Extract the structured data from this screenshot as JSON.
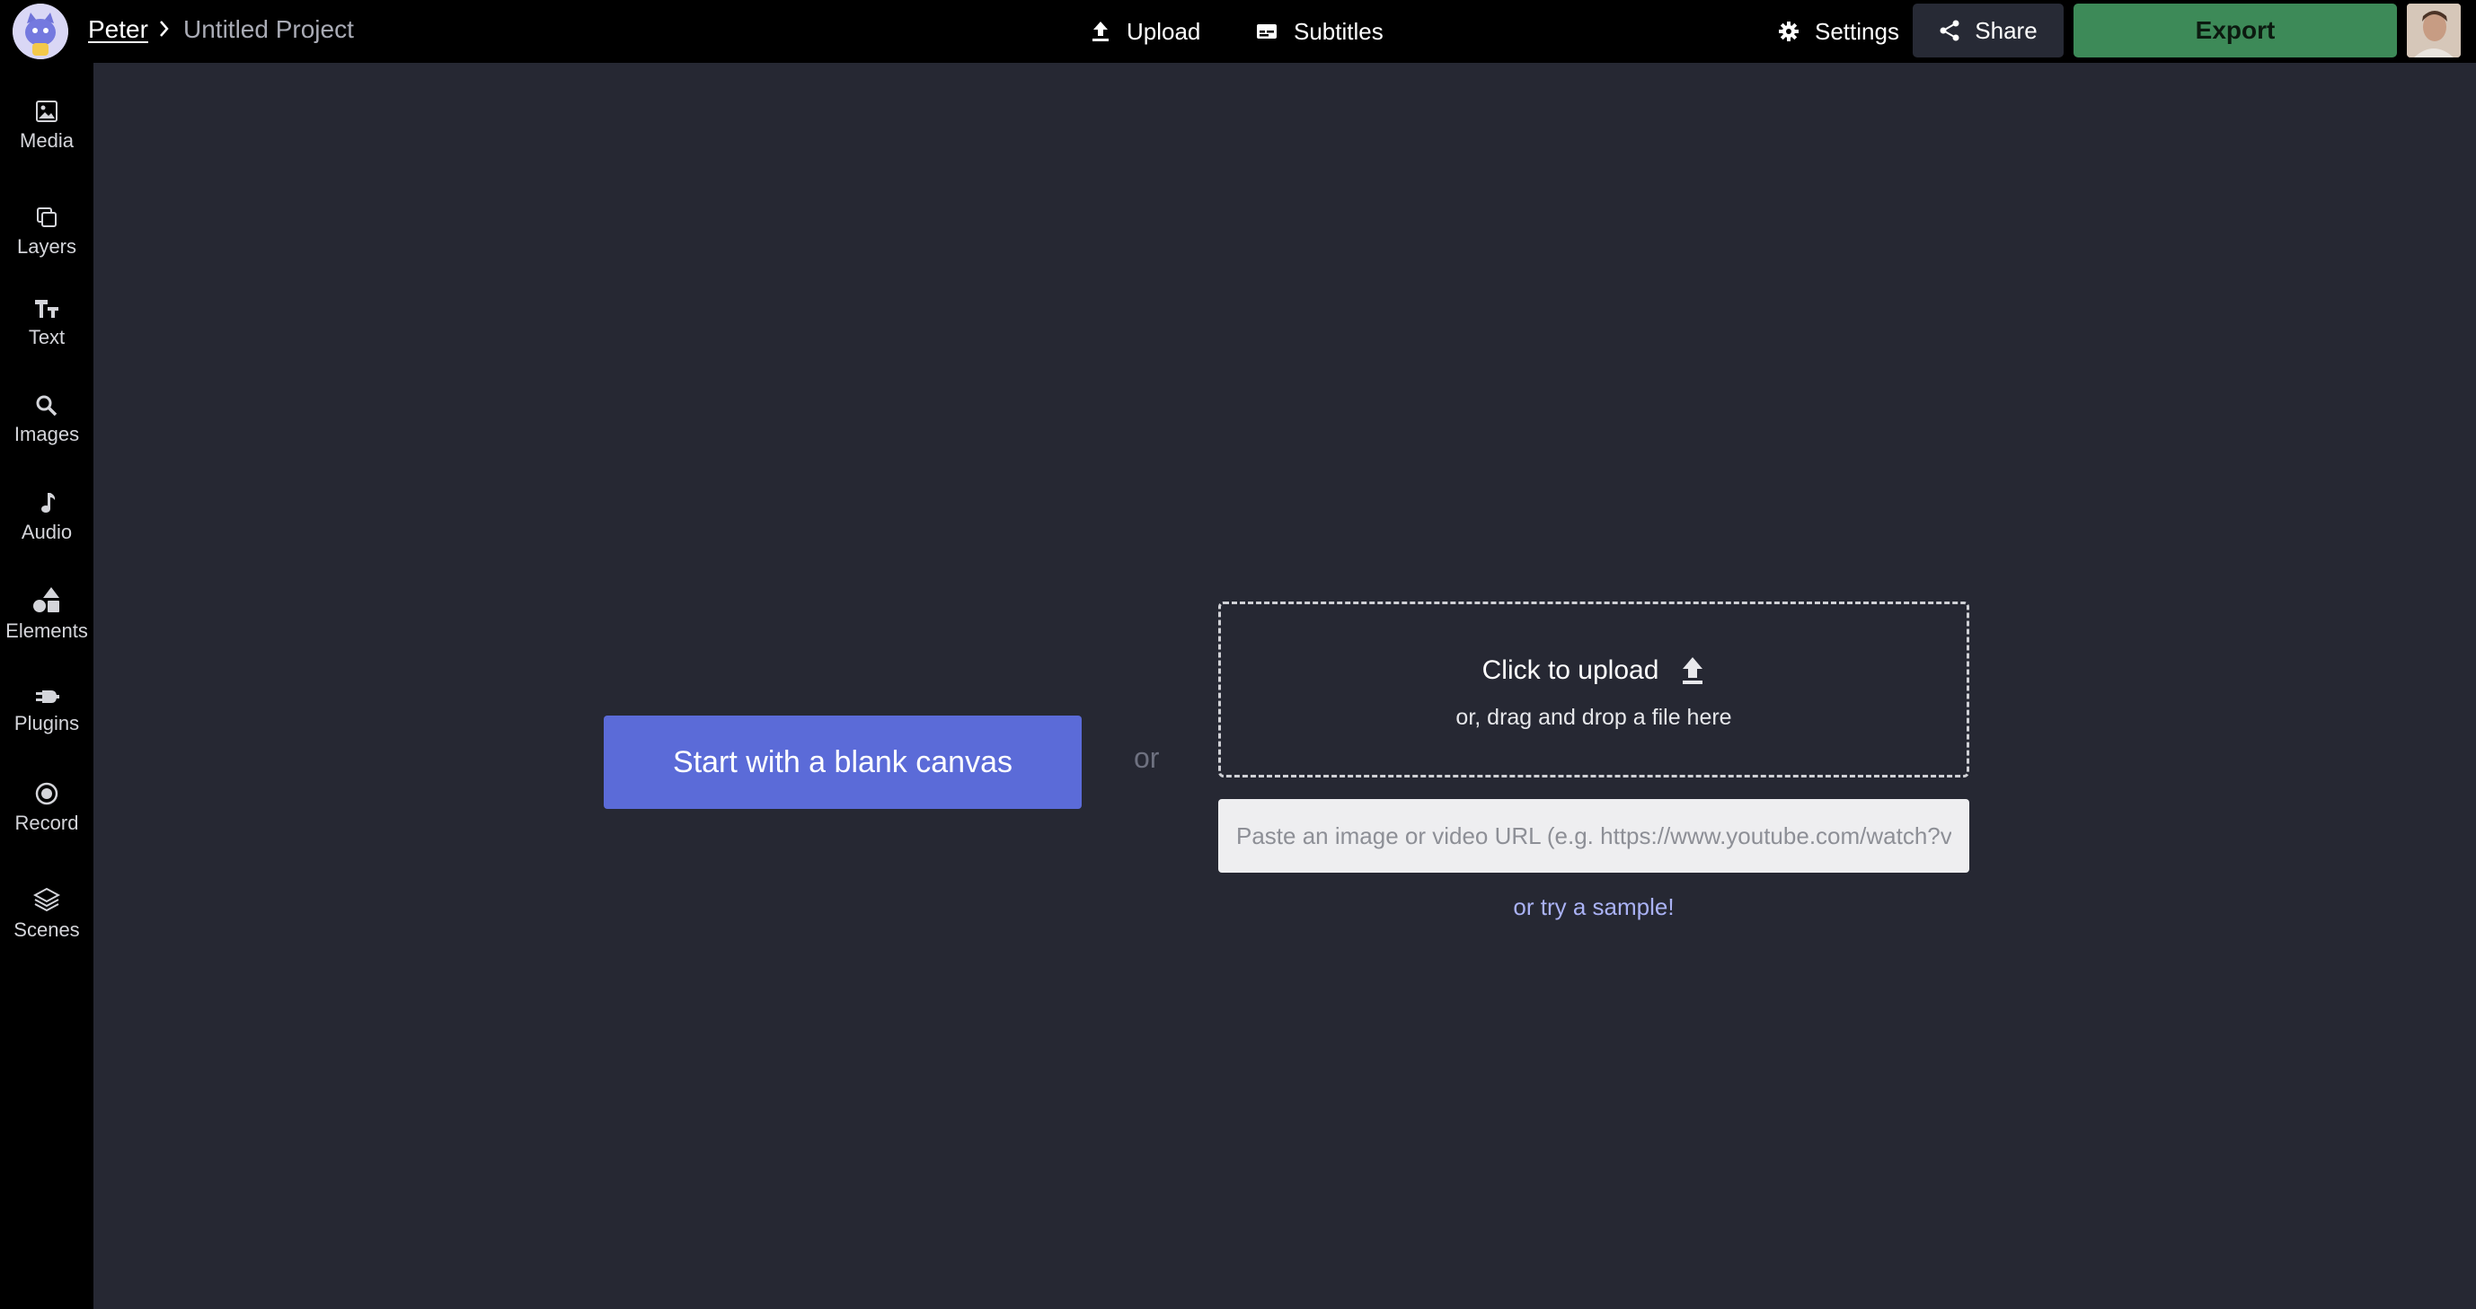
{
  "header": {
    "user": "Peter",
    "project_title": "Untitled Project",
    "upload_label": "Upload",
    "subtitles_label": "Subtitles",
    "settings_label": "Settings",
    "share_label": "Share",
    "export_label": "Export"
  },
  "sidebar": {
    "items": [
      {
        "label": "Media",
        "icon": "image-icon"
      },
      {
        "label": "Layers",
        "icon": "layers-icon"
      },
      {
        "label": "Text",
        "icon": "text-icon"
      },
      {
        "label": "Images",
        "icon": "search-icon"
      },
      {
        "label": "Audio",
        "icon": "music-note-icon"
      },
      {
        "label": "Elements",
        "icon": "shapes-icon"
      },
      {
        "label": "Plugins",
        "icon": "plug-icon"
      },
      {
        "label": "Record",
        "icon": "record-icon"
      },
      {
        "label": "Scenes",
        "icon": "stack-icon"
      }
    ]
  },
  "main": {
    "blank_canvas_label": "Start with a blank canvas",
    "or_label": "or",
    "dropzone_title": "Click to upload",
    "dropzone_subtitle": "or, drag and drop a file here",
    "url_placeholder": "Paste an image or video URL (e.g. https://www.youtube.com/watch?v=C",
    "sample_label": "or try a sample!"
  },
  "colors": {
    "background": "#262833",
    "bar": "#000000",
    "primary": "#5b6bd8",
    "export": "#3d8a58",
    "link": "#aab2f5"
  }
}
